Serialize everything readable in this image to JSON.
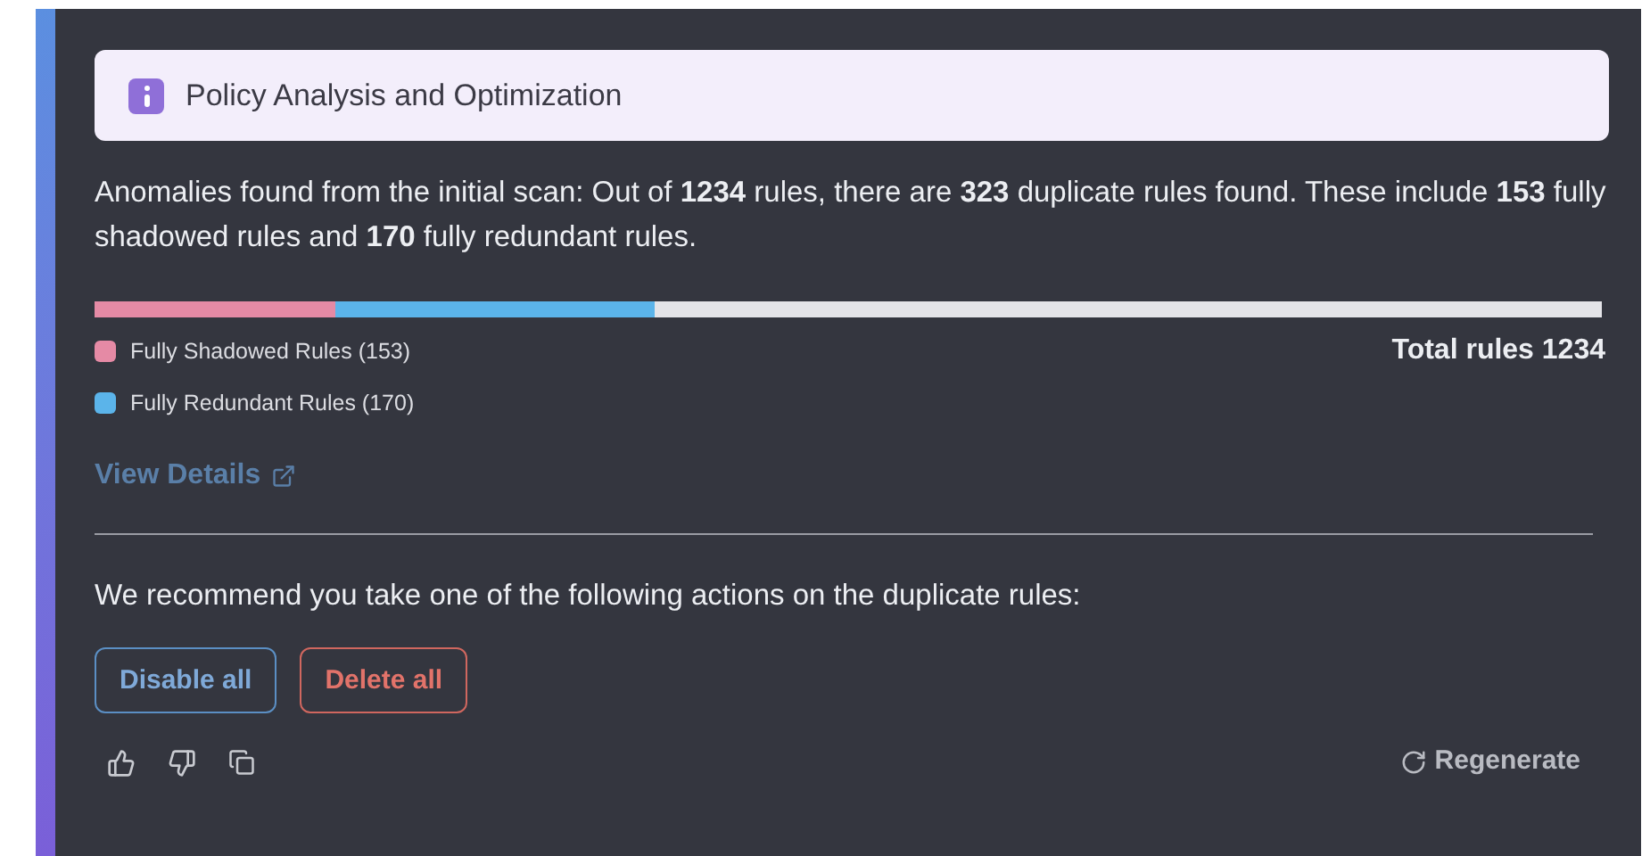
{
  "banner": {
    "title": "Policy Analysis and Optimization"
  },
  "summary": "Anomalies found from the initial scan: Out of **1234** rules, there are **323** duplicate rules found. These include **153** fully shadowed rules and **170** fully redundant rules.",
  "breakdown": {
    "segments": [
      {
        "label": "Fully Shadowed Rules (153)",
        "color": "#e58aa5",
        "level": 0.16
      },
      {
        "label": "Fully Redundant Rules (170)",
        "color": "#5bb4ea",
        "level": 0.212
      }
    ],
    "total": "Total rules 1234"
  },
  "view_details": "View Details",
  "recommendation": "We recommend you take one of the following actions on the duplicate rules:",
  "actions": [
    {
      "label": "Disable all",
      "kind": "disable"
    },
    {
      "label": "Delete all",
      "kind": "delete"
    }
  ],
  "regenerate": "Regenerate"
}
